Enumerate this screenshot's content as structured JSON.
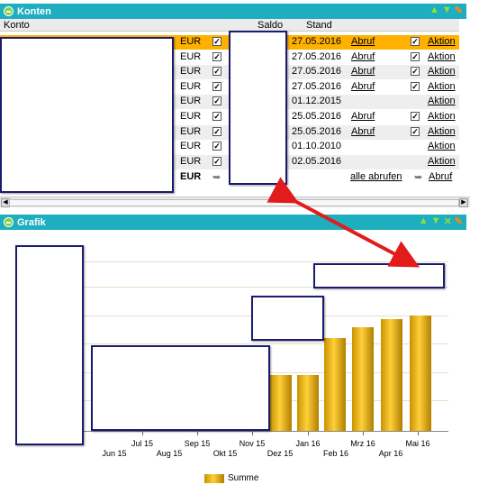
{
  "konten": {
    "title": "Konten",
    "columns": {
      "konto": "Konto",
      "saldo": "Saldo",
      "stand": "Stand"
    },
    "rows": [
      {
        "currency": "EUR",
        "checked": true,
        "stand": "27.05.2016",
        "abruf": "Abruf",
        "abruf_checked": true,
        "aktion": "Aktion",
        "selected": true
      },
      {
        "currency": "EUR",
        "checked": true,
        "stand": "27.05.2016",
        "abruf": "Abruf",
        "abruf_checked": true,
        "aktion": "Aktion"
      },
      {
        "currency": "EUR",
        "checked": true,
        "stand": "27.05.2016",
        "abruf": "Abruf",
        "abruf_checked": true,
        "aktion": "Aktion"
      },
      {
        "currency": "EUR",
        "checked": true,
        "stand": "27.05.2016",
        "abruf": "Abruf",
        "abruf_checked": true,
        "aktion": "Aktion"
      },
      {
        "currency": "EUR",
        "checked": true,
        "stand": "01.12.2015",
        "abruf": "",
        "abruf_checked": false,
        "aktion": "Aktion"
      },
      {
        "currency": "EUR",
        "checked": true,
        "stand": "25.05.2016",
        "abruf": "Abruf",
        "abruf_checked": true,
        "aktion": "Aktion"
      },
      {
        "currency": "EUR",
        "checked": true,
        "stand": "25.05.2016",
        "abruf": "Abruf",
        "abruf_checked": true,
        "aktion": "Aktion"
      },
      {
        "currency": "EUR",
        "checked": true,
        "stand": "01.10.2010",
        "abruf": "",
        "abruf_checked": false,
        "aktion": "Aktion"
      },
      {
        "currency": "EUR",
        "checked": true,
        "stand": "02.05.2016",
        "abruf": "",
        "abruf_checked": false,
        "aktion": "Aktion"
      }
    ],
    "total": {
      "currency": "EUR",
      "alle_abrufen": "alle abrufen",
      "abruf": "Abruf"
    }
  },
  "grafik": {
    "title": "Grafik",
    "legend": "Summe"
  },
  "chart_data": {
    "type": "bar",
    "x_upper": [
      "Jul 15",
      "Sep 15",
      "Nov 15",
      "Jan 16",
      "Mrz 16",
      "Mai 16"
    ],
    "x_lower": [
      "Jun 15",
      "Aug 15",
      "Okt 15",
      "Dez 15",
      "Feb 16",
      "Apr 16"
    ],
    "series": [
      {
        "name": "Summe",
        "values_visible_fraction": [
          0.33,
          0.33,
          0.55,
          0.61,
          0.66,
          0.68
        ]
      }
    ]
  }
}
